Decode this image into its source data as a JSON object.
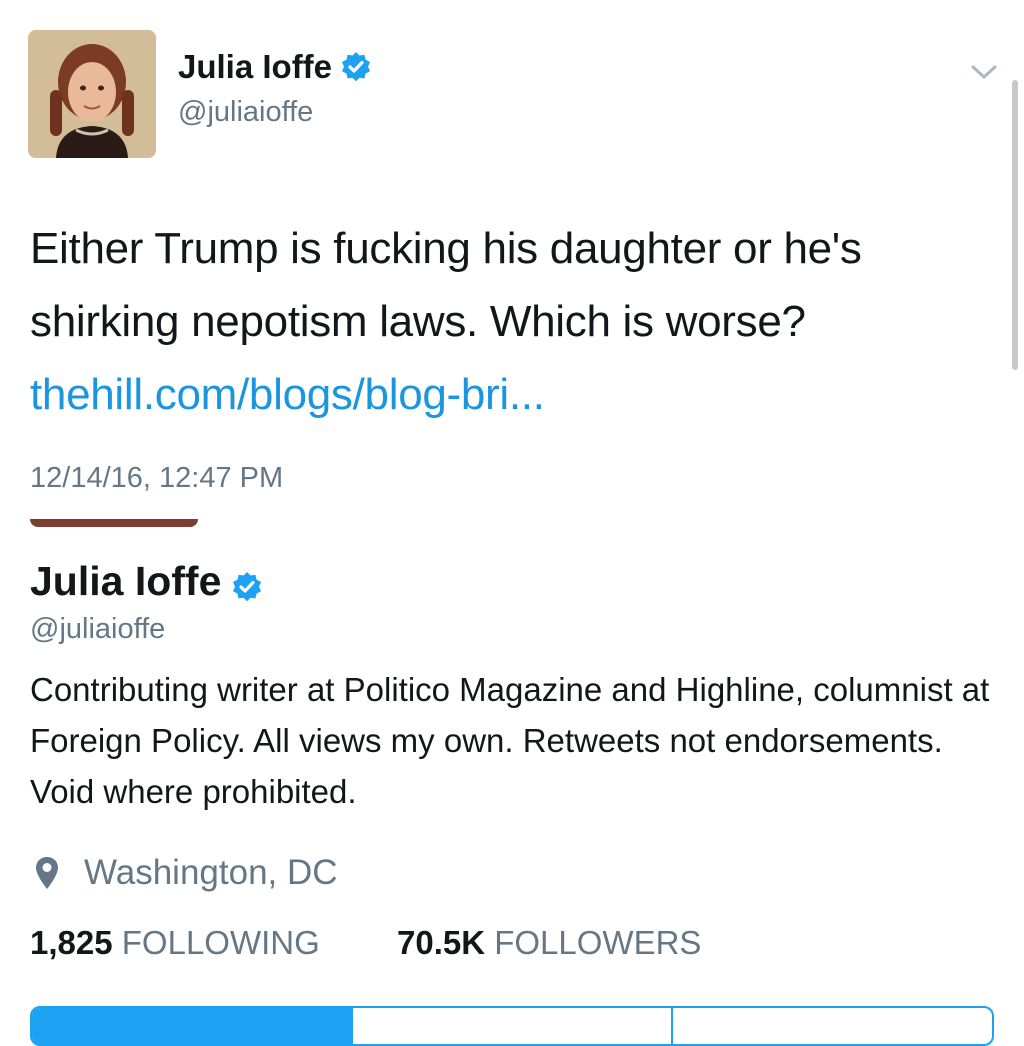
{
  "tweet": {
    "author_name": "Julia Ioffe",
    "author_handle": "@juliaioffe",
    "text": "Either Trump is fucking his daughter  or he's shirking nepotism laws. Which is worse?",
    "link": "thehill.com/blogs/blog-bri...",
    "timestamp": "12/14/16, 12:47 PM"
  },
  "profile": {
    "name": "Julia Ioffe",
    "handle": "@juliaioffe",
    "bio": "Contributing writer at Politico Magazine and Highline, columnist at Foreign Policy. All views my own. Retweets not endorsements. Void where prohibited.",
    "location": "Washington, DC",
    "following_count": "1,825",
    "following_label": "FOLLOWING",
    "followers_count": "70.5K",
    "followers_label": "FOLLOWERS"
  },
  "icons": {
    "verified": "verified-badge-icon",
    "menu": "chevron-down-icon",
    "location": "location-pin-icon"
  },
  "colors": {
    "accent": "#1da1f2",
    "link": "#1b95e0",
    "secondary_text": "#657786",
    "primary_text": "#14171a"
  }
}
